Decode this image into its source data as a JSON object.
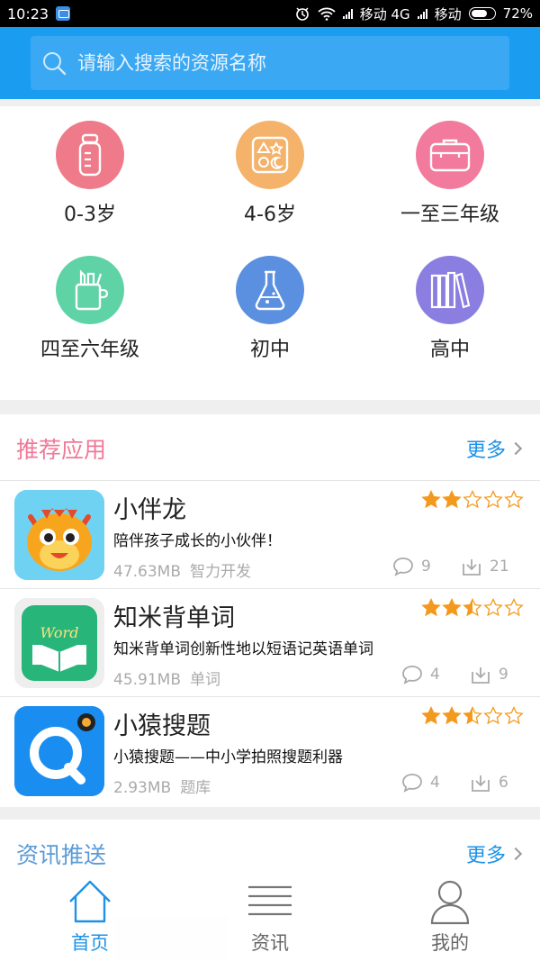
{
  "status_bar": {
    "time": "10:23",
    "carrier1": "移动 4G",
    "carrier2": "移动",
    "battery": "72%",
    "battery_level": 0.72
  },
  "search": {
    "placeholder": "请输入搜索的资源名称"
  },
  "categories": [
    {
      "label": "0-3岁",
      "icon": "baby-bottle-icon",
      "color": "#ef7b8a"
    },
    {
      "label": "4-6岁",
      "icon": "toy-blocks-icon",
      "color": "#f4b26a"
    },
    {
      "label": "一至三年级",
      "icon": "schoolbag-icon",
      "color": "#f27a9c"
    },
    {
      "label": "四至六年级",
      "icon": "pencil-cup-icon",
      "color": "#5fd3a6"
    },
    {
      "label": "初中",
      "icon": "flask-icon",
      "color": "#5b8fe0"
    },
    {
      "label": "高中",
      "icon": "books-icon",
      "color": "#8a7ee0"
    }
  ],
  "recommended": {
    "title": "推荐应用",
    "more": "更多",
    "apps": [
      {
        "name": "小伴龙",
        "desc": "陪伴孩子成长的小伙伴！",
        "size": "47.63MB",
        "category": "智力开发",
        "comments": "9",
        "downloads": "21",
        "rating": 2,
        "icon": "dragon-app-icon"
      },
      {
        "name": "知米背单词",
        "desc": "知米背单词创新性地以短语记英语单词",
        "size": "45.91MB",
        "category": "单词",
        "comments": "4",
        "downloads": "9",
        "rating": 2.5,
        "icon": "word-book-app-icon"
      },
      {
        "name": "小猿搜题",
        "desc": "小猿搜题——中小学拍照搜题利器",
        "size": "2.93MB",
        "category": "题库",
        "comments": "4",
        "downloads": "6",
        "rating": 2.5,
        "icon": "search-q-app-icon"
      }
    ]
  },
  "news": {
    "title": "资讯推送",
    "more": "更多"
  },
  "bottom_nav": [
    {
      "label": "首页",
      "icon": "home-icon",
      "active": true
    },
    {
      "label": "资讯",
      "icon": "news-list-icon",
      "active": false
    },
    {
      "label": "我的",
      "icon": "profile-icon",
      "active": false
    }
  ],
  "colors": {
    "primary": "#1a9cf0",
    "accent_pink": "#f07898",
    "link_blue": "#1e92e6",
    "star_orange": "#f39a1e"
  }
}
